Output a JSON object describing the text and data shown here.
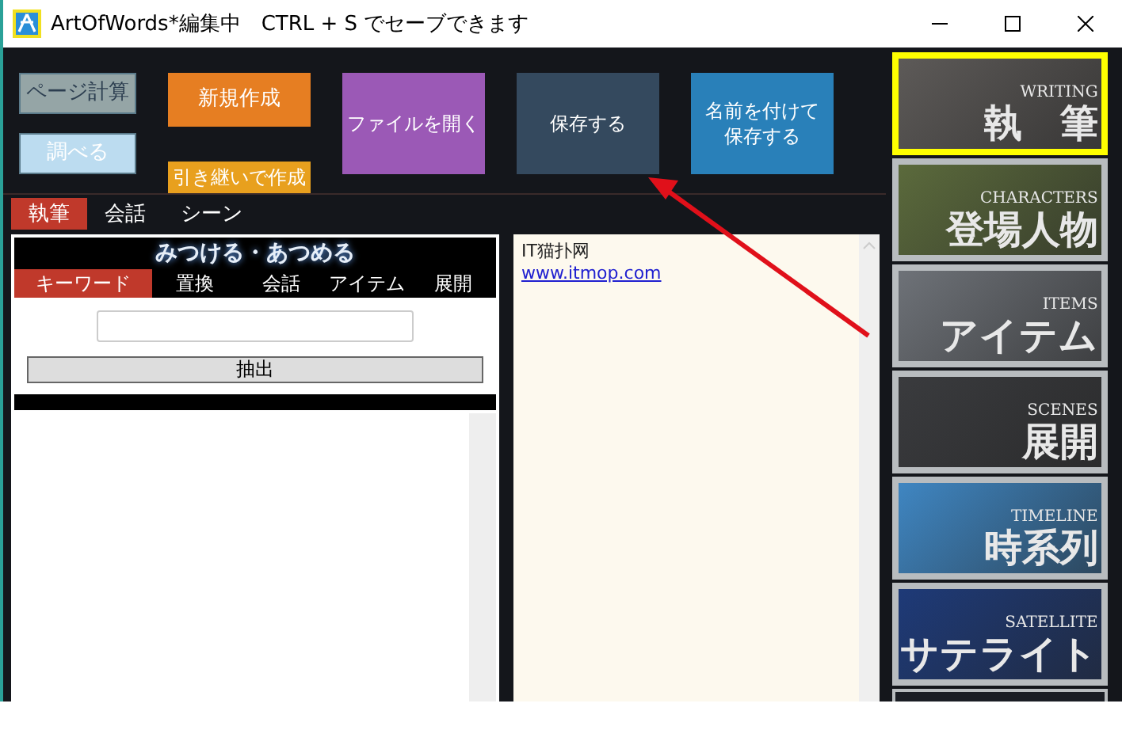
{
  "window": {
    "title": "ArtOfWords*編集中　CTRL + S でセーブできます"
  },
  "toolbar": {
    "columns": [
      [
        {
          "label": "ページ計算",
          "color": "#95a5a6",
          "kind": "small"
        },
        {
          "label": "調べる",
          "color": "#bcdcf0",
          "kind": "small"
        }
      ],
      [
        {
          "label": "新規作成",
          "color": "#e67e22",
          "kind": "medium"
        },
        {
          "label": "引き継いで作成",
          "color": "#e8a01e",
          "kind": "short"
        }
      ],
      [
        {
          "label": "ファイルを開く",
          "color": "#9b59b6",
          "kind": "large"
        }
      ],
      [
        {
          "label": "保存する",
          "color": "#34495e",
          "kind": "large"
        }
      ],
      [
        {
          "lines": [
            "名前を付けて",
            "保存する"
          ],
          "color": "#2980b9",
          "kind": "large"
        }
      ]
    ]
  },
  "tabs": [
    {
      "label": "執筆",
      "selected": true
    },
    {
      "label": "会話",
      "selected": false
    },
    {
      "label": "シーン",
      "selected": false
    }
  ],
  "search_panel": {
    "title": "みつける・あつめる",
    "tabs": [
      {
        "label": "キーワード",
        "selected": true
      },
      {
        "label": "置換",
        "selected": false
      },
      {
        "label": "会話",
        "selected": false
      },
      {
        "label": "アイテム",
        "selected": false
      },
      {
        "label": "展開",
        "selected": false
      }
    ],
    "button": "抽出"
  },
  "editor": {
    "lines": [
      {
        "text": "IT猫扑网",
        "kind": "text"
      },
      {
        "text": "www.itmop.com",
        "kind": "link"
      }
    ]
  },
  "sidebar": [
    {
      "english": "WRITING",
      "label": "執　筆",
      "color": "#5d5a58",
      "selected": true
    },
    {
      "english": "CHARACTERS",
      "label": "登場人物",
      "color": "#5b6a3c",
      "selected": false
    },
    {
      "english": "ITEMS",
      "label": "アイテム",
      "color": "#6e7278",
      "selected": false
    },
    {
      "english": "SCENES",
      "label": "展開",
      "color": "#3a3b3e",
      "selected": false
    },
    {
      "english": "TIMELINE",
      "label": "時系列",
      "color": "#3f86c2",
      "selected": false
    },
    {
      "english": "SATELLITE",
      "label": "サテライト",
      "color": "#1e3a78",
      "selected": false
    }
  ],
  "annotation": {
    "kind": "arrow"
  }
}
